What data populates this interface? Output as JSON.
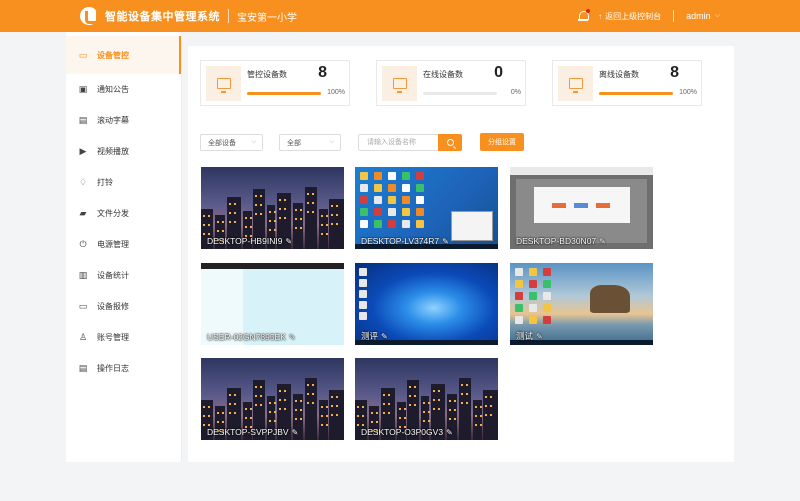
{
  "header": {
    "app_title": "智能设备集中管理系统",
    "school": "宝安第一小学",
    "back_label": "返回上级控制台",
    "user": "admin",
    "chevron_glyph": "⌵",
    "up_glyph": "↑"
  },
  "sidebar": {
    "items": [
      {
        "label": "设备管控",
        "icon": "monitor-icon",
        "glyph": "▭",
        "active": true
      },
      {
        "label": "通知公告",
        "icon": "notice-icon",
        "glyph": "▣"
      },
      {
        "label": "滚动字幕",
        "icon": "marquee-icon",
        "glyph": "▤"
      },
      {
        "label": "视频播放",
        "icon": "video-icon",
        "glyph": "▶"
      },
      {
        "label": "打铃",
        "icon": "bell-icon",
        "glyph": "♢"
      },
      {
        "label": "文件分发",
        "icon": "folder-icon",
        "glyph": "▰"
      },
      {
        "label": "电源管理",
        "icon": "power-icon",
        "glyph": "⏻"
      },
      {
        "label": "设备统计",
        "icon": "stats-icon",
        "glyph": "▥"
      },
      {
        "label": "设备报修",
        "icon": "repair-icon",
        "glyph": "▭"
      },
      {
        "label": "账号管理",
        "icon": "account-icon",
        "glyph": "♙"
      },
      {
        "label": "操作日志",
        "icon": "log-icon",
        "glyph": "▤"
      }
    ]
  },
  "stats": [
    {
      "label": "管控设备数",
      "value": "8",
      "percent_text": "100%",
      "fill": 1.0
    },
    {
      "label": "在线设备数",
      "value": "0",
      "percent_text": "0%",
      "fill": 0.0
    },
    {
      "label": "离线设备数",
      "value": "8",
      "percent_text": "100%",
      "fill": 1.0
    }
  ],
  "filters": {
    "device_select": "全部设备",
    "status_select": "全部",
    "search_placeholder": "请输入设备名称",
    "group_button": "分组设置"
  },
  "devices": [
    {
      "name": "DESKTOP-HB9INI9",
      "screen": "city"
    },
    {
      "name": "DESKTOP-LV374R7",
      "screen": "desktop-blue"
    },
    {
      "name": "DESKTOP-BD30N07",
      "screen": "desktop-gray"
    },
    {
      "name": "USER-02GN7895EK",
      "screen": "desktop-light"
    },
    {
      "name": "测评",
      "screen": "win10"
    },
    {
      "name": "测试",
      "screen": "beach"
    },
    {
      "name": "DESKTOP-SVPPJBV",
      "screen": "city"
    },
    {
      "name": "DESKTOP-O3P0GV3",
      "screen": "city"
    }
  ],
  "colors": {
    "accent": "#f7901e"
  }
}
